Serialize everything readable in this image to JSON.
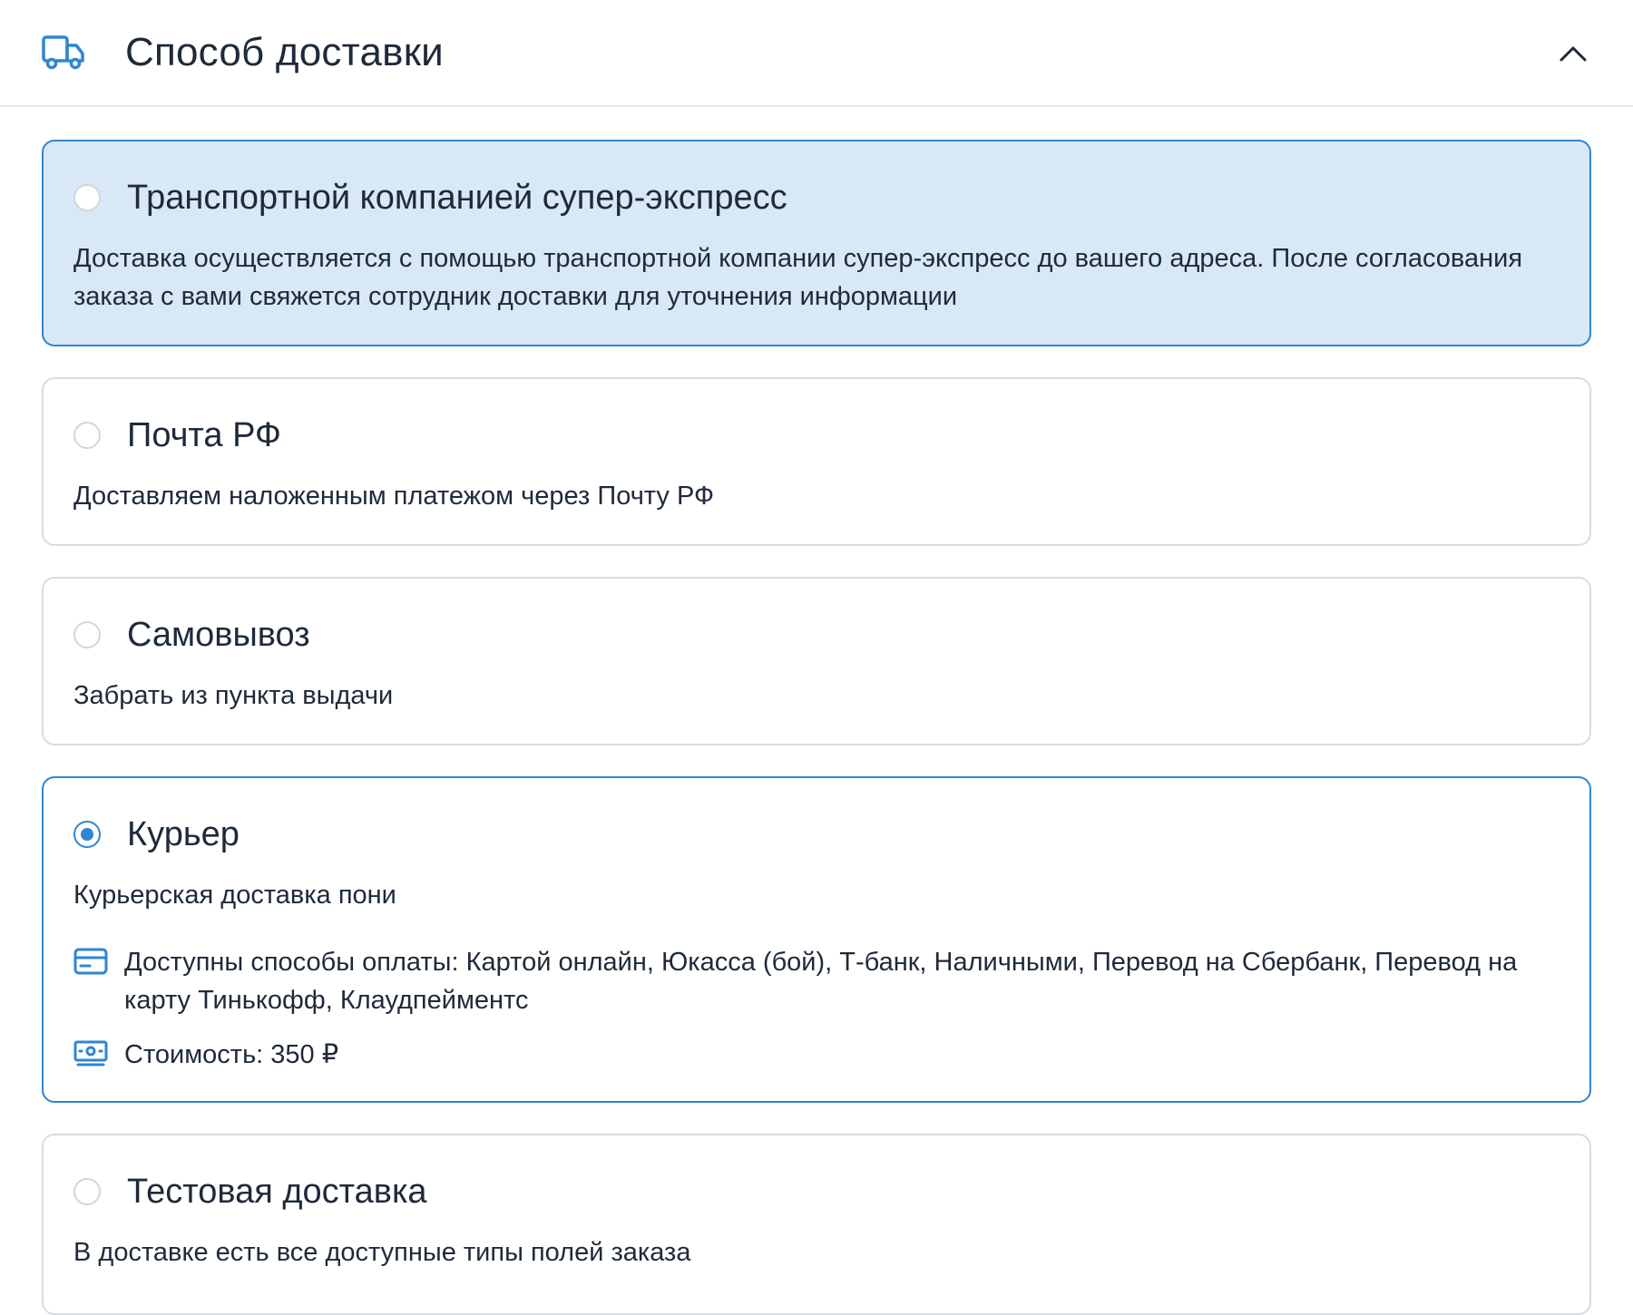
{
  "header": {
    "title": "Способ доставки",
    "icon": "truck-icon",
    "collapse_icon": "chevron-up-icon"
  },
  "colors": {
    "accent": "#2f86d1",
    "highlight_bg": "#d8e8f6",
    "border": "#d9dce0",
    "text": "#1e2a3a"
  },
  "options": [
    {
      "title": "Транспортной компанией супер-экспресс",
      "description": "Доставка осуществляется с помощью транспортной компании супер-экспресс до вашего адреса. После согласования заказа с вами свяжется сотрудник доставки для уточнения информации",
      "selected": false
    },
    {
      "title": "Почта РФ",
      "description": "Доставляем наложенным платежом через Почту РФ",
      "selected": false
    },
    {
      "title": "Самовывоз",
      "description": "Забрать из пункта выдачи",
      "selected": false
    },
    {
      "title": "Курьер",
      "description": "Курьерская доставка пони",
      "payment_methods": "Доступны способы оплаты: Картой онлайн, Юкасса (бой), Т-банк, Наличными, Перевод на Сбербанк, Перевод на карту Тинькофф, Клаудпейментс",
      "cost": "Стоимость: 350 ₽",
      "selected": true
    },
    {
      "title": "Тестовая доставка",
      "description": "В доставке есть все доступные типы полей заказа",
      "selected": false
    }
  ]
}
